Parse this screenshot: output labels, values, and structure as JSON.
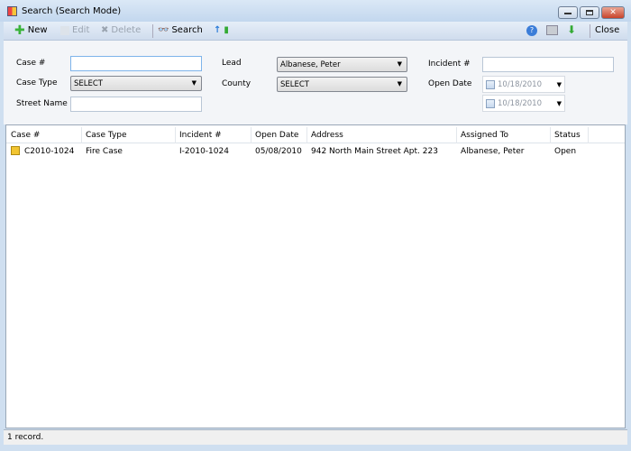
{
  "window": {
    "title": "Search (Search Mode)",
    "close_label": "Close"
  },
  "toolbar": {
    "new": "New",
    "edit": "Edit",
    "delete": "Delete",
    "search": "Search"
  },
  "form": {
    "case_label": "Case #",
    "case_value": "",
    "case_type_label": "Case Type",
    "case_type_value": "SELECT",
    "street_label": "Street Name",
    "street_value": "",
    "lead_label": "Lead",
    "lead_value": "Albanese, Peter",
    "county_label": "County",
    "county_value": "SELECT",
    "incident_label": "Incident #",
    "incident_value": "",
    "open_date_label": "Open Date",
    "open_date_from": "10/18/2010",
    "open_date_to": "10/18/2010"
  },
  "grid": {
    "columns": [
      "Case #",
      "Case Type",
      "Incident #",
      "Open Date",
      "Address",
      "Assigned To",
      "Status"
    ],
    "rows": [
      [
        "C2010-1024",
        "Fire Case",
        "I-2010-1024",
        "05/08/2010",
        "942 North Main Street Apt. 223",
        "Albanese, Peter",
        "Open"
      ]
    ]
  },
  "status": "1 record."
}
